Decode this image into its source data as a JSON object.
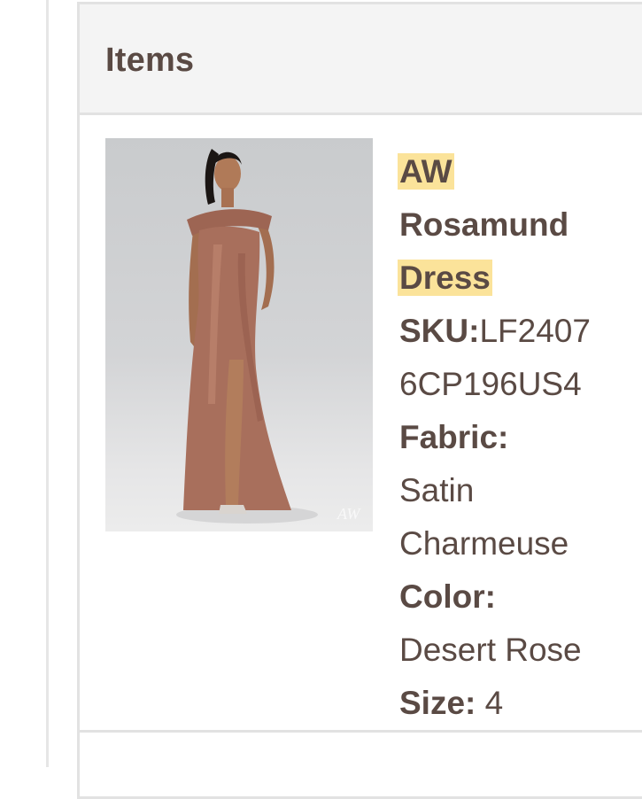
{
  "section": {
    "title": "Items"
  },
  "item": {
    "name_line1": "AW",
    "name_line2": "Rosamund",
    "name_line3": "Dress",
    "sku_label": "SKU:",
    "sku_value_line1": "LF2407",
    "sku_value_line2": "6CP196US4",
    "fabric_label": "Fabric:",
    "fabric_value_line1": "Satin",
    "fabric_value_line2": "Charmeuse",
    "color_label": "Color:",
    "color_value": "Desert Rose",
    "size_label": "Size:",
    "size_value": "4",
    "image_watermark": "AW"
  },
  "colors": {
    "highlight": "#fbe39a",
    "text": "#5a4a44",
    "dress": "#a86f5c"
  }
}
